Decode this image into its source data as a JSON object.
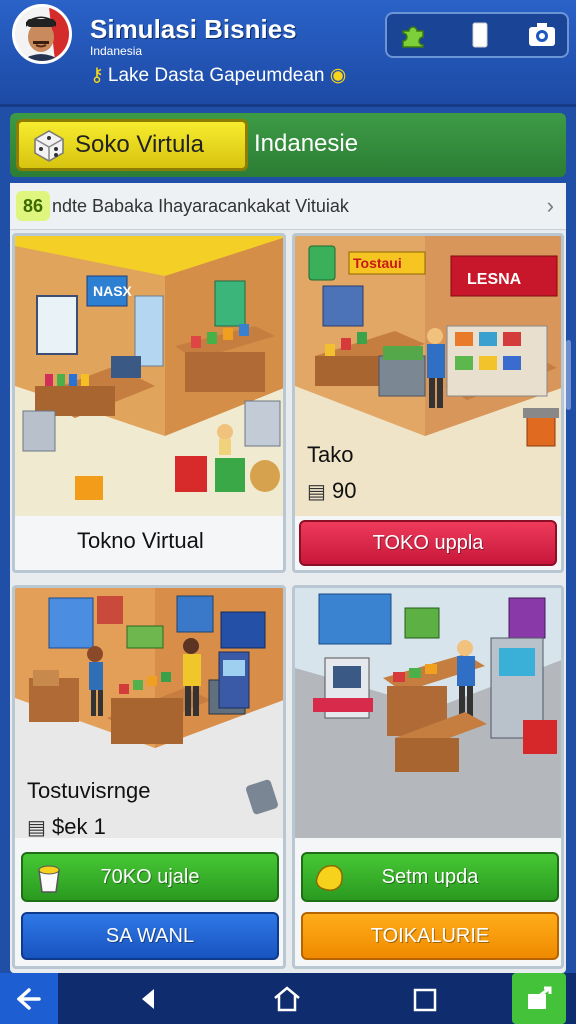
{
  "header": {
    "title": "Simulasi Bisnies",
    "subtitle": "Indanesia",
    "tagline": "Lake Dasta Gapeumdean",
    "icons": [
      "puzzle-icon",
      "phone-icon",
      "camera-icon"
    ]
  },
  "banner": {
    "button_label": "Soko Virtula",
    "text": "Indanesie"
  },
  "breadcrumb": {
    "icon_text": "86",
    "text": "ndte Babaka Ihayaracankakat Vituiak"
  },
  "cards": [
    {
      "sign": "NASX",
      "name": "Tokno Virtual"
    },
    {
      "signs": [
        "Tostaui",
        "LESNA"
      ],
      "name": "Tako",
      "stat": "90",
      "button": "TOKO uppla"
    },
    {
      "name": "Tostuvisrnge",
      "stat": "$ek 1",
      "button_primary": "70KO ujale",
      "button_secondary": "SA WANL"
    },
    {
      "button_primary": "Setm upda",
      "button_secondary": "TOIKALURIE"
    }
  ],
  "colors": {
    "header": "#1d4aa5",
    "banner": "#2c7d35",
    "red_button": "#d7234a",
    "green_button": "#34ad28",
    "blue_button": "#1e5fd0",
    "orange_button": "#f79a0c"
  },
  "nav": [
    "back-icon",
    "triangle-back-icon",
    "home-icon",
    "square-recent-icon",
    "share-icon"
  ]
}
